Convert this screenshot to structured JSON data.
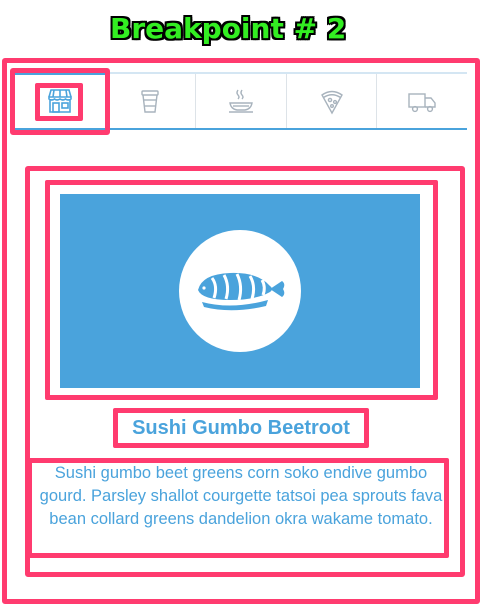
{
  "annotation": {
    "label": "Breakpoint # 2",
    "outline_color": "#ff3b6f",
    "label_color": "#33ee22"
  },
  "tabs": [
    {
      "id": "store",
      "icon": "store-icon",
      "active": true
    },
    {
      "id": "coffee",
      "icon": "coffee-cup-icon",
      "active": false
    },
    {
      "id": "hot-dish",
      "icon": "hot-dish-icon",
      "active": false
    },
    {
      "id": "pizza",
      "icon": "pizza-slice-icon",
      "active": false
    },
    {
      "id": "delivery",
      "icon": "delivery-truck-icon",
      "active": false
    }
  ],
  "panel": {
    "image_icon": "sushi-icon",
    "image_bg": "#4aa3dc",
    "title": "Sushi Gumbo Beetroot",
    "description": "Sushi gumbo beet greens corn soko endive gumbo gourd. Parsley shallot courgette tatsoi pea sprouts fava bean collard greens dandelion okra wakame tomato."
  },
  "accent_color": "#4aa3dc"
}
